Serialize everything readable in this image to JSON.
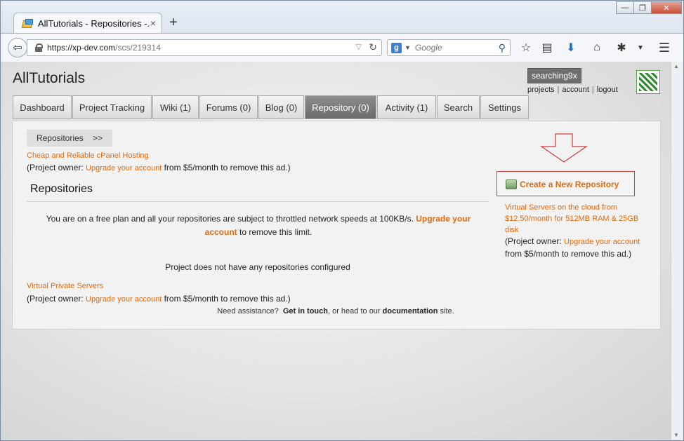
{
  "browser": {
    "tab_title": "AllTutorials - Repositories -...",
    "tab_close": "×",
    "new_tab": "+",
    "url_host": "https://xp-dev.com",
    "url_path": "/scs/219314",
    "search_provider": "g",
    "search_placeholder": "Google",
    "window_controls": [
      "—",
      "❐",
      "✕"
    ],
    "toolbar_icons": [
      "star-icon",
      "reading-list-icon",
      "download-icon",
      "home-icon",
      "extension-icon",
      "menu-icon"
    ]
  },
  "site": {
    "title": "AllTutorials",
    "username": "searching9x",
    "user_links": [
      "projects",
      "account",
      "logout"
    ]
  },
  "nav_tabs": [
    {
      "label": "Dashboard",
      "active": false
    },
    {
      "label": "Project Tracking",
      "active": false
    },
    {
      "label": "Wiki (1)",
      "active": false
    },
    {
      "label": "Forums (0)",
      "active": false
    },
    {
      "label": "Blog (0)",
      "active": false
    },
    {
      "label": "Repository (0)",
      "active": true
    },
    {
      "label": "Activity (1)",
      "active": false
    },
    {
      "label": "Search",
      "active": false
    },
    {
      "label": "Settings",
      "active": false
    }
  ],
  "breadcrumb": "Repositories    >>",
  "ad_top": {
    "link": "Cheap and Reliable cPanel Hosting",
    "note_pre": "(Project owner: ",
    "note_link": "Upgrade your account",
    "note_post": " from $5/month to remove this ad.)"
  },
  "section_title": "Repositories",
  "notice": {
    "pre": "You are on a free plan and all your repositories are subject to throttled network speeds at 100KB/s. ",
    "link": "Upgrade your account",
    "post": " to remove this limit."
  },
  "empty_message": "Project does not have any repositories configured",
  "ad_bottom": {
    "link": "Virtual Private Servers",
    "note_pre": "(Project owner: ",
    "note_link": "Upgrade your account",
    "note_post": " from $5/month to remove this ad.)"
  },
  "assist": {
    "pre": "Need assistance?  ",
    "contact": "Get in touch",
    "mid": ", or head to our ",
    "docs": "documentation",
    "post": " site."
  },
  "create_button": "Create a New Repository",
  "side_ad": {
    "link": "Virtual Servers on the cloud from $12.50/month for 512MB RAM & 25GB disk",
    "note_pre": "(Project owner: ",
    "note_link": "Upgrade your account",
    "note_post": " from $5/month to remove this ad.)"
  },
  "colors": {
    "accent": "#e06b10",
    "active_tab": "#777777",
    "highlight_box": "#d23a3a"
  }
}
